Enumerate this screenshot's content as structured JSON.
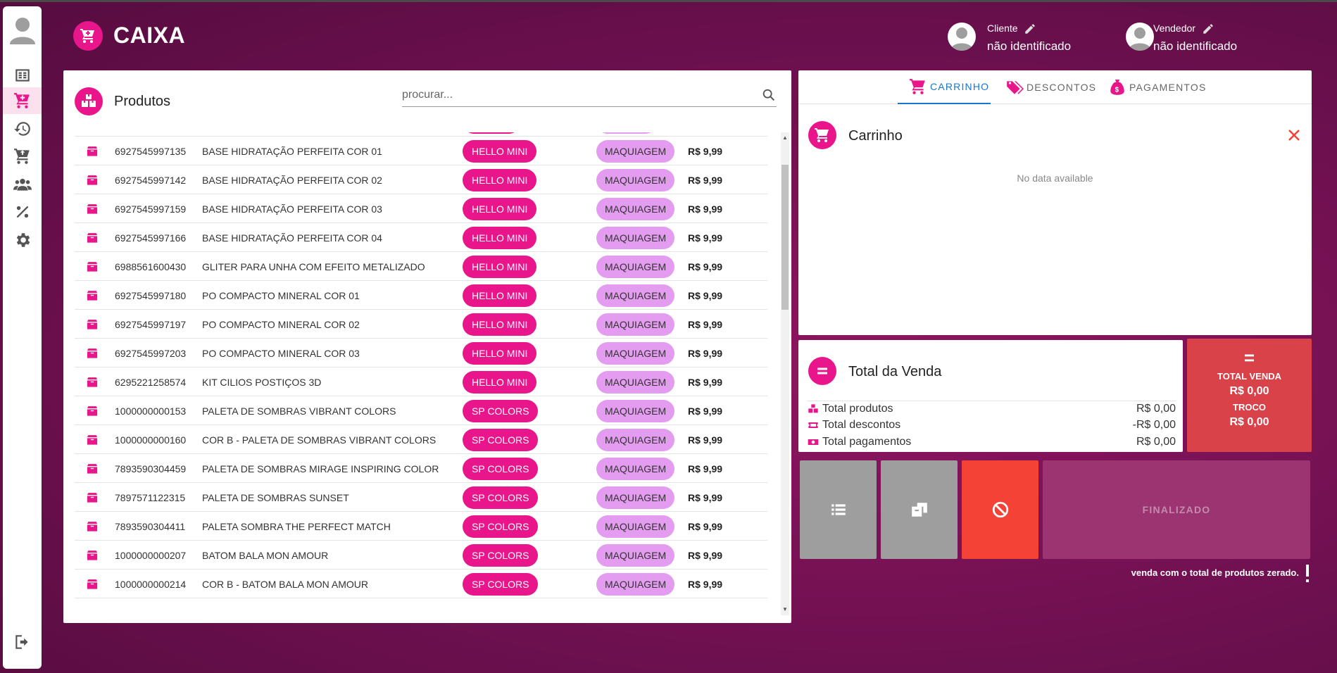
{
  "header": {
    "title": "CAIXA",
    "cliente_label": "Cliente",
    "cliente_value": "não identificado",
    "vendedor_label": "Vendedor",
    "vendedor_value": "não identificado"
  },
  "sidebar": {
    "items": [
      {
        "icon": "catalog-icon",
        "active": false
      },
      {
        "icon": "cart-plus-icon",
        "active": true
      },
      {
        "icon": "history-icon",
        "active": false
      },
      {
        "icon": "cart-arrow-icon",
        "active": false
      },
      {
        "icon": "users-icon",
        "active": false
      },
      {
        "icon": "percent-icon",
        "active": false
      },
      {
        "icon": "gear-icon",
        "active": false
      }
    ],
    "logout_icon": "logout-icon"
  },
  "products": {
    "title": "Produtos",
    "search_placeholder": "procurar...",
    "rows": [
      {
        "code": "6927545997135",
        "name": "BASE HIDRATAÇÃO PERFEITA COR 01",
        "brand": "HELLO MINI",
        "category": "MAQUIAGEM",
        "price": "R$ 9,99"
      },
      {
        "code": "6927545997142",
        "name": "BASE HIDRATAÇÃO PERFEITA COR 02",
        "brand": "HELLO MINI",
        "category": "MAQUIAGEM",
        "price": "R$ 9,99"
      },
      {
        "code": "6927545997159",
        "name": "BASE HIDRATAÇÃO PERFEITA COR 03",
        "brand": "HELLO MINI",
        "category": "MAQUIAGEM",
        "price": "R$ 9,99"
      },
      {
        "code": "6927545997166",
        "name": "BASE HIDRATAÇÃO PERFEITA COR 04",
        "brand": "HELLO MINI",
        "category": "MAQUIAGEM",
        "price": "R$ 9,99"
      },
      {
        "code": "6988561600430",
        "name": "GLITER PARA UNHA COM EFEITO METALIZADO",
        "brand": "HELLO MINI",
        "category": "MAQUIAGEM",
        "price": "R$ 9,99"
      },
      {
        "code": "6927545997180",
        "name": "PO COMPACTO MINERAL COR 01",
        "brand": "HELLO MINI",
        "category": "MAQUIAGEM",
        "price": "R$ 9,99"
      },
      {
        "code": "6927545997197",
        "name": "PO COMPACTO MINERAL COR 02",
        "brand": "HELLO MINI",
        "category": "MAQUIAGEM",
        "price": "R$ 9,99"
      },
      {
        "code": "6927545997203",
        "name": "PO COMPACTO MINERAL COR 03",
        "brand": "HELLO MINI",
        "category": "MAQUIAGEM",
        "price": "R$ 9,99"
      },
      {
        "code": "6295221258574",
        "name": "KIT CILIOS POSTIÇOS 3D",
        "brand": "HELLO MINI",
        "category": "MAQUIAGEM",
        "price": "R$ 9,99"
      },
      {
        "code": "1000000000153",
        "name": "PALETA DE SOMBRAS VIBRANT COLORS",
        "brand": "SP COLORS",
        "category": "MAQUIAGEM",
        "price": "R$ 9,99"
      },
      {
        "code": "1000000000160",
        "name": "COR B - PALETA DE SOMBRAS VIBRANT COLORS",
        "brand": "SP COLORS",
        "category": "MAQUIAGEM",
        "price": "R$ 9,99"
      },
      {
        "code": "7893590304459",
        "name": "PALETA DE SOMBRAS MIRAGE INSPIRING COLOR",
        "brand": "SP COLORS",
        "category": "MAQUIAGEM",
        "price": "R$ 9,99"
      },
      {
        "code": "7897571122315",
        "name": "PALETA DE SOMBRAS SUNSET",
        "brand": "SP COLORS",
        "category": "MAQUIAGEM",
        "price": "R$ 9,99"
      },
      {
        "code": "7893590304411",
        "name": "PALETA SOMBRA THE PERFECT MATCH",
        "brand": "SP COLORS",
        "category": "MAQUIAGEM",
        "price": "R$ 9,99"
      },
      {
        "code": "1000000000207",
        "name": "BATOM BALA MON AMOUR",
        "brand": "SP COLORS",
        "category": "MAQUIAGEM",
        "price": "R$ 9,99"
      },
      {
        "code": "1000000000214",
        "name": "COR B - BATOM BALA MON AMOUR",
        "brand": "SP COLORS",
        "category": "MAQUIAGEM",
        "price": "R$ 9,99"
      }
    ]
  },
  "cart": {
    "tabs": [
      "CARRINHO",
      "DESCONTOS",
      "PAGAMENTOS"
    ],
    "active_tab": "CARRINHO",
    "title": "Carrinho",
    "empty_text": "No data available"
  },
  "totals": {
    "title": "Total da Venda",
    "produtos_label": "Total produtos",
    "produtos_value": "R$ 0,00",
    "descontos_label": "Total descontos",
    "descontos_value": "-R$ 0,00",
    "pagamentos_label": "Total pagamentos",
    "pagamentos_value": "R$ 0,00"
  },
  "summary": {
    "symbol": "=",
    "total_label": "TOTAL VENDA",
    "total_value": "R$ 0,00",
    "troco_label": "TROCO",
    "troco_value": "R$ 0,00"
  },
  "actions": {
    "finalize_label": "FINALIZADO",
    "warning": "venda com o total de produtos zerado."
  },
  "colors": {
    "accent": "#e8168a",
    "category_chip": "#e49cf0",
    "danger": "#f44336",
    "summary_bg": "#d94249",
    "tab_active": "#1976d2"
  }
}
